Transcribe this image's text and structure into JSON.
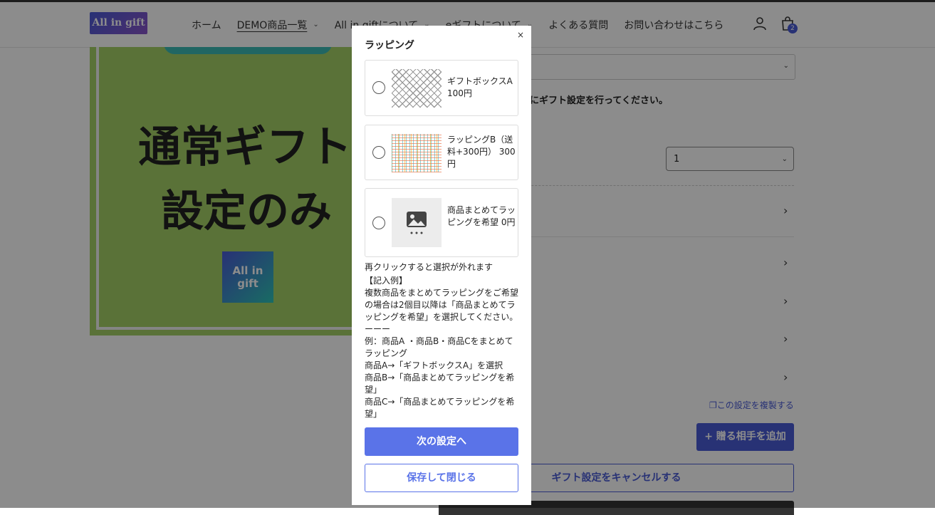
{
  "header": {
    "logo_text": "All in gift",
    "nav": [
      {
        "label": "ホーム",
        "dropdown": false,
        "active": false
      },
      {
        "label": "DEMO商品一覧",
        "dropdown": true,
        "active": true
      },
      {
        "label": "All in giftについて",
        "dropdown": true,
        "active": false
      },
      {
        "label": "eギフトについて",
        "dropdown": true,
        "active": false
      },
      {
        "label": "よくある質問",
        "dropdown": false,
        "active": false
      },
      {
        "label": "お問い合わせはこちら",
        "dropdown": false,
        "active": false
      }
    ],
    "cart_count": "2"
  },
  "product": {
    "image_text_line1": "通常ギフト",
    "image_text_line2": "設定のみ",
    "mini_logo_line1": "All in",
    "mini_logo_line2": "gift"
  },
  "right": {
    "notice": "にギフト設定を行ってください。",
    "quantity": "1",
    "copy_link": "この設定を複製する",
    "add_button": "+ 贈る相手を追加",
    "cancel_button": "ギフト設定をキャンセルする"
  },
  "modal": {
    "close": "×",
    "title": "ラッピング",
    "options": [
      {
        "label": "ギフトボックスA 100円"
      },
      {
        "label": "ラッピングB（送料+300円） 300円"
      },
      {
        "label": "商品まとめてラッピングを希望 0円"
      }
    ],
    "hint": "再クリックすると選択が外れます",
    "example_lines": [
      "【記入例】",
      "複数商品をまとめてラッピングをご希望の場合は2個目以降は「商品まとめてラッピングを希望」を選択してください。",
      "ーーー",
      "例：商品A ・商品B・商品Cをまとめてラッピング",
      "商品A→「ギフトボックスA」を選択",
      "商品B→「商品まとめてラッピングを希望」",
      "商品C→「商品まとめてラッピングを希望」"
    ],
    "next_button": "次の設定へ",
    "save_button": "保存して閉じる"
  },
  "colors": {
    "accent": "#5a73e8",
    "brand": "#4a5bd6",
    "product_bg": "#a4d067"
  }
}
